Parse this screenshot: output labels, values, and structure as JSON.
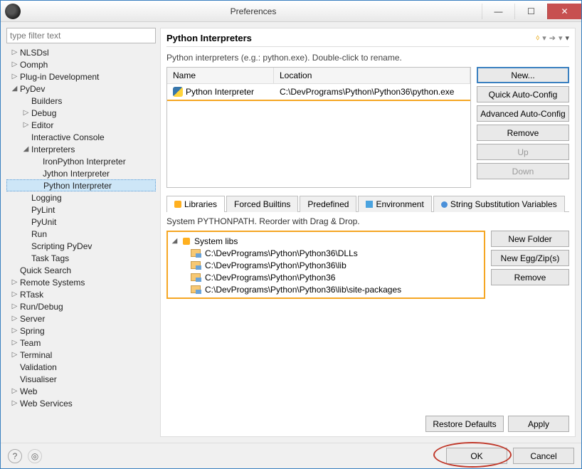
{
  "window": {
    "title": "Preferences"
  },
  "filter": {
    "placeholder": "type filter text"
  },
  "tree": {
    "items": [
      {
        "label": "NLSDsl",
        "depth": 1,
        "tw": "▷"
      },
      {
        "label": "Oomph",
        "depth": 1,
        "tw": "▷"
      },
      {
        "label": "Plug-in Development",
        "depth": 1,
        "tw": "▷"
      },
      {
        "label": "PyDev",
        "depth": 1,
        "tw": "◢"
      },
      {
        "label": "Builders",
        "depth": 2,
        "tw": ""
      },
      {
        "label": "Debug",
        "depth": 2,
        "tw": "▷"
      },
      {
        "label": "Editor",
        "depth": 2,
        "tw": "▷"
      },
      {
        "label": "Interactive Console",
        "depth": 2,
        "tw": ""
      },
      {
        "label": "Interpreters",
        "depth": 2,
        "tw": "◢"
      },
      {
        "label": "IronPython Interpreter",
        "depth": 3,
        "tw": ""
      },
      {
        "label": "Jython Interpreter",
        "depth": 3,
        "tw": ""
      },
      {
        "label": "Python Interpreter",
        "depth": 3,
        "tw": "",
        "selected": true
      },
      {
        "label": "Logging",
        "depth": 2,
        "tw": ""
      },
      {
        "label": "PyLint",
        "depth": 2,
        "tw": ""
      },
      {
        "label": "PyUnit",
        "depth": 2,
        "tw": ""
      },
      {
        "label": "Run",
        "depth": 2,
        "tw": ""
      },
      {
        "label": "Scripting PyDev",
        "depth": 2,
        "tw": ""
      },
      {
        "label": "Task Tags",
        "depth": 2,
        "tw": ""
      },
      {
        "label": "Quick Search",
        "depth": 1,
        "tw": ""
      },
      {
        "label": "Remote Systems",
        "depth": 1,
        "tw": "▷"
      },
      {
        "label": "RTask",
        "depth": 1,
        "tw": "▷"
      },
      {
        "label": "Run/Debug",
        "depth": 1,
        "tw": "▷"
      },
      {
        "label": "Server",
        "depth": 1,
        "tw": "▷"
      },
      {
        "label": "Spring",
        "depth": 1,
        "tw": "▷"
      },
      {
        "label": "Team",
        "depth": 1,
        "tw": "▷"
      },
      {
        "label": "Terminal",
        "depth": 1,
        "tw": "▷"
      },
      {
        "label": "Validation",
        "depth": 1,
        "tw": ""
      },
      {
        "label": "Visualiser",
        "depth": 1,
        "tw": ""
      },
      {
        "label": "Web",
        "depth": 1,
        "tw": "▷"
      },
      {
        "label": "Web Services",
        "depth": 1,
        "tw": "▷"
      }
    ]
  },
  "page": {
    "title": "Python Interpreters",
    "desc": "Python interpreters (e.g.: python.exe).   Double-click to rename.",
    "table": {
      "col_name": "Name",
      "col_location": "Location",
      "row_name": "Python Interpreter",
      "row_location": "C:\\DevPrograms\\Python\\Python36\\python.exe"
    },
    "btns": {
      "new": "New...",
      "quick": "Quick Auto-Config",
      "advanced": "Advanced Auto-Config",
      "remove": "Remove",
      "up": "Up",
      "down": "Down"
    },
    "tabs": {
      "libraries": "Libraries",
      "forced": "Forced Builtins",
      "predefined": "Predefined",
      "environment": "Environment",
      "ssv": "String Substitution Variables"
    },
    "sys_desc": "System PYTHONPATH.   Reorder with Drag & Drop.",
    "systemlibs_label": "System libs",
    "libs": [
      "C:\\DevPrograms\\Python\\Python36\\DLLs",
      "C:\\DevPrograms\\Python\\Python36\\lib",
      "C:\\DevPrograms\\Python\\Python36",
      "C:\\DevPrograms\\Python\\Python36\\lib\\site-packages"
    ],
    "btns2": {
      "newfolder": "New Folder",
      "newegg": "New Egg/Zip(s)",
      "remove": "Remove"
    },
    "restore": "Restore Defaults",
    "apply": "Apply"
  },
  "footer": {
    "ok": "OK",
    "cancel": "Cancel"
  }
}
